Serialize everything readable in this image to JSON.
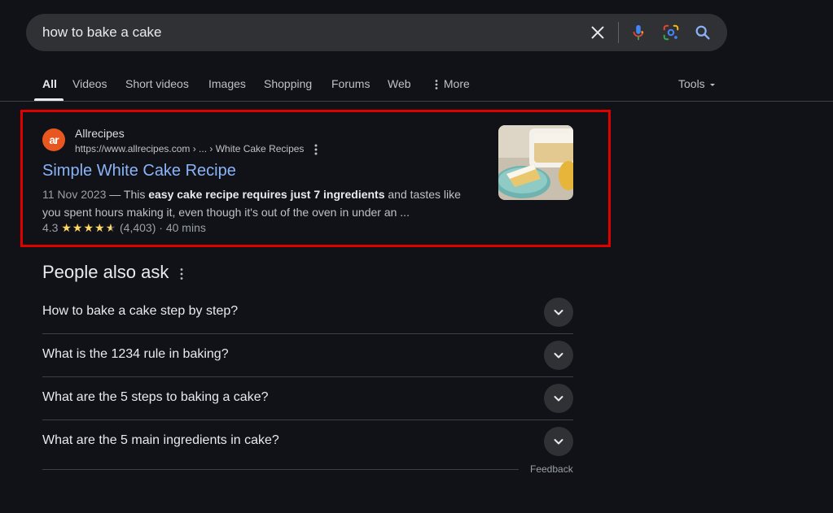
{
  "search": {
    "query": "how to bake a cake",
    "icons": [
      "close-icon",
      "microphone-icon",
      "google-lens-icon",
      "search-icon"
    ]
  },
  "tabs": {
    "items": [
      {
        "label": "All",
        "active": true
      },
      {
        "label": "Videos"
      },
      {
        "label": "Short videos"
      },
      {
        "label": "Images"
      },
      {
        "label": "Shopping"
      },
      {
        "label": "Forums"
      },
      {
        "label": "Web"
      },
      {
        "label": "More"
      }
    ],
    "tools_label": "Tools"
  },
  "result": {
    "favicon_text": "ar",
    "site_name": "Allrecipes",
    "url": "https://www.allrecipes.com › ... › White Cake Recipes",
    "title": "Simple White Cake Recipe",
    "date": "11 Nov 2023",
    "snippet_sep": " — ",
    "snippet_plain_1": "This ",
    "snippet_bold": "easy cake recipe requires just 7 ingredients",
    "snippet_plain_2": " and tastes like you spent hours making it, even though it's out of the oven in under an ...",
    "rating": "4.3",
    "stars": "★★★★",
    "half_star": "★",
    "reviews": "(4,403)",
    "duration": "40 mins",
    "dot": "·",
    "highlight_color": "#e00000"
  },
  "paa": {
    "title": "People also ask",
    "questions": [
      "How to bake a cake step by step?",
      "What is the 1234 rule in baking?",
      "What are the 5 steps to baking a cake?",
      "What are the 5 main ingredients in cake?"
    ],
    "feedback": "Feedback"
  },
  "colors": {
    "background": "#101218",
    "link": "#8ab4f8",
    "star": "#fdd663"
  }
}
